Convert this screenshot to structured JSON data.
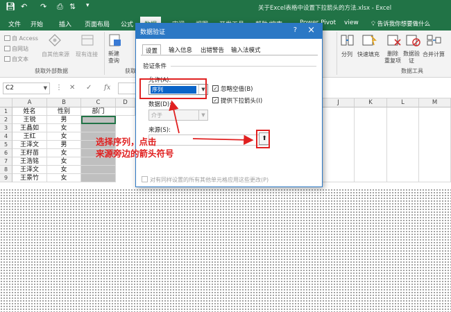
{
  "window": {
    "title": "关于Excel表格中设置下拉箭头的方法.xlsx  -  Excel",
    "quick_access": [
      "save-icon",
      "undo-icon",
      "redo-icon",
      "print-preview-icon",
      "sort-icon"
    ]
  },
  "tabs": [
    {
      "label": "文件"
    },
    {
      "label": "开始"
    },
    {
      "label": "插入"
    },
    {
      "label": "页面布局"
    },
    {
      "label": "公式"
    },
    {
      "label": "数据"
    },
    {
      "label": "审阅"
    },
    {
      "label": "视图"
    },
    {
      "label": "开发工具"
    },
    {
      "label": "帮助/搜索"
    },
    {
      "label": "Power Pivot"
    },
    {
      "label": "view"
    }
  ],
  "tell_me": "告诉我你想要做什么",
  "ribbon": {
    "access": "自 Access",
    "web": "自网站",
    "text": "自文本",
    "other_sources": "自其他来源",
    "existing": "现有连接",
    "new_query": "新建\n查询",
    "group_external": "获取外部数据",
    "group_transform": "获取",
    "split": "分列",
    "flash_fill": "快速填充",
    "remove_dup": "删除\n重复项",
    "validation": "数据验\n证",
    "consolidate": "合并计算",
    "group_tools": "数据工具"
  },
  "formula_bar": {
    "name_box": "C2",
    "fx": "fx"
  },
  "grid": {
    "columns": [
      "A",
      "B",
      "C",
      "D",
      "J",
      "K",
      "L",
      "M"
    ],
    "rows": [
      "1",
      "2",
      "3",
      "4",
      "5",
      "6",
      "7",
      "8",
      "9"
    ],
    "header_row": [
      "姓名",
      "性别",
      "部门"
    ],
    "data": [
      [
        "王锐",
        "男"
      ],
      [
        "王晶如",
        "女"
      ],
      [
        "王红",
        "女"
      ],
      [
        "王泽文",
        "男"
      ],
      [
        "王籽苗",
        "女"
      ],
      [
        "王浩铭",
        "女"
      ],
      [
        "王泽文",
        "女"
      ],
      [
        "王景竹",
        "女"
      ]
    ]
  },
  "dialog": {
    "title": "数据验证",
    "help": "?",
    "close": "×",
    "tabs": [
      "设置",
      "输入信息",
      "出错警告",
      "输入法模式"
    ],
    "section": "验证条件",
    "allow_label": "允许(A):",
    "allow_value": "序列",
    "ignore_blank": "忽略空值(B)",
    "dropdown": "提供下拉箭头(I)",
    "data_label": "数据(D):",
    "data_value": "介于",
    "source_label": "来源(S):",
    "source_value": "",
    "apply_all": "对有同样设置的所有其他单元格应用这些更改(P)"
  },
  "annotation": {
    "line1": "选择序列，点击",
    "line2": "来源旁边的箭头符号"
  },
  "colors": {
    "excel_green": "#217346",
    "dialog_blue": "#2b78c5",
    "annotation_red": "#e02020",
    "selection_blue": "#0a64c8"
  }
}
